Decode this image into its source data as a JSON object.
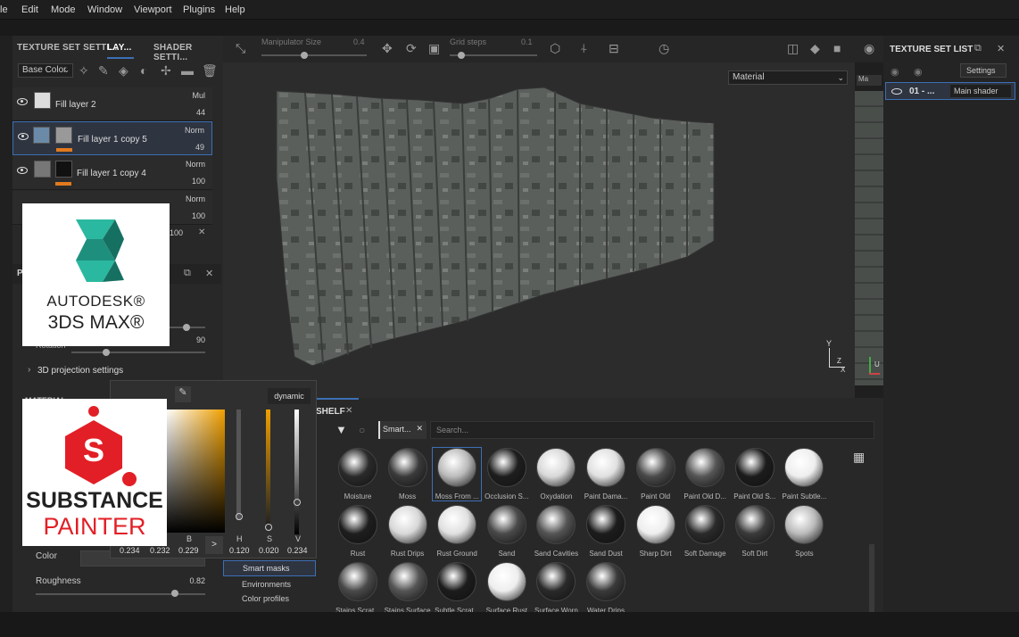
{
  "menu": {
    "items": [
      "le",
      "Edit",
      "Mode",
      "Window",
      "Viewport",
      "Plugins",
      "Help"
    ]
  },
  "toolbar": {
    "manipulator_label": "Manipulator Size",
    "manipulator_value": "0.4",
    "grid_label": "Grid steps",
    "grid_value": "0.1"
  },
  "left_panel": {
    "tabs": [
      "TEXTURE SET SETTI...",
      "LAY...",
      "SHADER SETTI..."
    ],
    "channel": "Base Color",
    "layers": [
      {
        "name": "Fill layer 2",
        "blend": "Mul",
        "opacity": "44"
      },
      {
        "name": "Fill layer 1 copy 5",
        "blend": "Norm",
        "opacity": "49"
      },
      {
        "name": "Fill layer 1 copy 4",
        "blend": "Norm",
        "opacity": "100"
      },
      {
        "name": "",
        "blend": "Norm",
        "opacity": "100"
      },
      {
        "name": "",
        "blend": "",
        "opacity": "100"
      }
    ],
    "rotation_label": "Rotation",
    "rotation_value": "90",
    "projection_label": "3D projection settings",
    "material_label": "MATERIAL",
    "color_label": "Color",
    "roughness_label": "Roughness",
    "roughness_value": "0.82",
    "panel_initial": "P"
  },
  "viewport": {
    "material_select": "Material"
  },
  "axes": {
    "y": "Y",
    "z": "Z",
    "x": "X",
    "u": "U"
  },
  "texture_set_list": {
    "title": "TEXTURE SET LIST",
    "settings": "Settings",
    "item_name": "01 - ...",
    "shader": "Main shader"
  },
  "right_column": {
    "ma": "Ma"
  },
  "color_picker": {
    "mode": "dynamic",
    "b_label": "B",
    "h_label": "H",
    "s_label": "S",
    "v_label": "V",
    "rgb_values": [
      "0.234",
      "0.232",
      "0.229"
    ],
    "hsv_values": [
      "0.120",
      "0.020",
      "0.234"
    ],
    "arrow": ">"
  },
  "shelf": {
    "title": "SHELF",
    "filter_chip": "Smart...",
    "search_placeholder": "Search...",
    "categories": [
      "Smart masks",
      "Environments",
      "Color profiles"
    ],
    "items_row1": [
      "Moisture",
      "Moss",
      "Moss From ...",
      "Occlusion S...",
      "Oxydation",
      "Paint Dama...",
      "Paint Old",
      "Paint Old D...",
      "Paint Old S...",
      "Paint Subtle..."
    ],
    "items_row2": [
      "Rust",
      "Rust Drips",
      "Rust Ground",
      "Sand",
      "Sand Cavities",
      "Sand Dust",
      "Sharp Dirt",
      "Soft Damage",
      "Soft Dirt",
      "Spots"
    ],
    "items_row3": [
      "Stains Scrat...",
      "Stains Surface",
      "Subtle Scrat...",
      "Surface Rust",
      "Surface Worn",
      "Water Drips"
    ]
  },
  "logos": {
    "max_brand": "AUTODESK®",
    "max_product": "3DS MAX®",
    "sp_line1": "SUBSTANCE",
    "sp_line2": "PAINTER"
  },
  "colors": {
    "accent": "#3d6fb5",
    "orange": "#e27a1f",
    "sp_red": "#e21f26",
    "max_teal": "#2bb8a0"
  }
}
